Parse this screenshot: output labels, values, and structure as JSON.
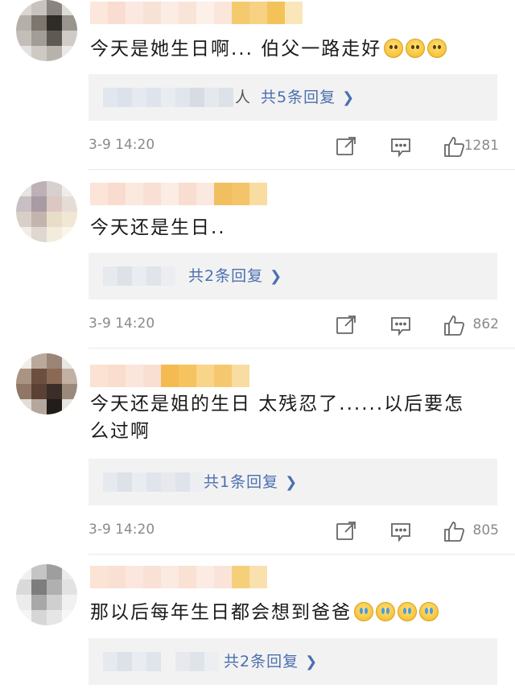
{
  "comments": [
    {
      "text": "今天是她生日啊... 伯父一路走好",
      "emojis": [
        "sad",
        "sad",
        "sad"
      ],
      "reply_link": "共5条回复",
      "reply_tail": "人",
      "time": "3-9 14:20",
      "likes": "1281"
    },
    {
      "text": "今天还是生日..",
      "emojis": [],
      "reply_link": "共2条回复",
      "reply_tail": "",
      "time": "3-9 14:20",
      "likes": "862"
    },
    {
      "text": "今天还是姐的生日 太残忍了......以后要怎么过啊",
      "emojis": [],
      "reply_link": "共1条回复",
      "reply_tail": "",
      "time": "3-9 14:20",
      "likes": "805"
    },
    {
      "text": "那以后每年生日都会想到爸爸",
      "emojis": [
        "cry",
        "cry",
        "cry",
        "cry"
      ],
      "reply_link": "共2条回复",
      "reply_tail": "",
      "time": "",
      "likes": ""
    }
  ],
  "icons": {
    "share": "share-icon",
    "comment": "comment-icon",
    "like": "thumbs-up-icon"
  },
  "colors": {
    "link": "#4b6fb0",
    "meta": "#8a8a8a",
    "reply_bg": "#f2f2f2"
  }
}
